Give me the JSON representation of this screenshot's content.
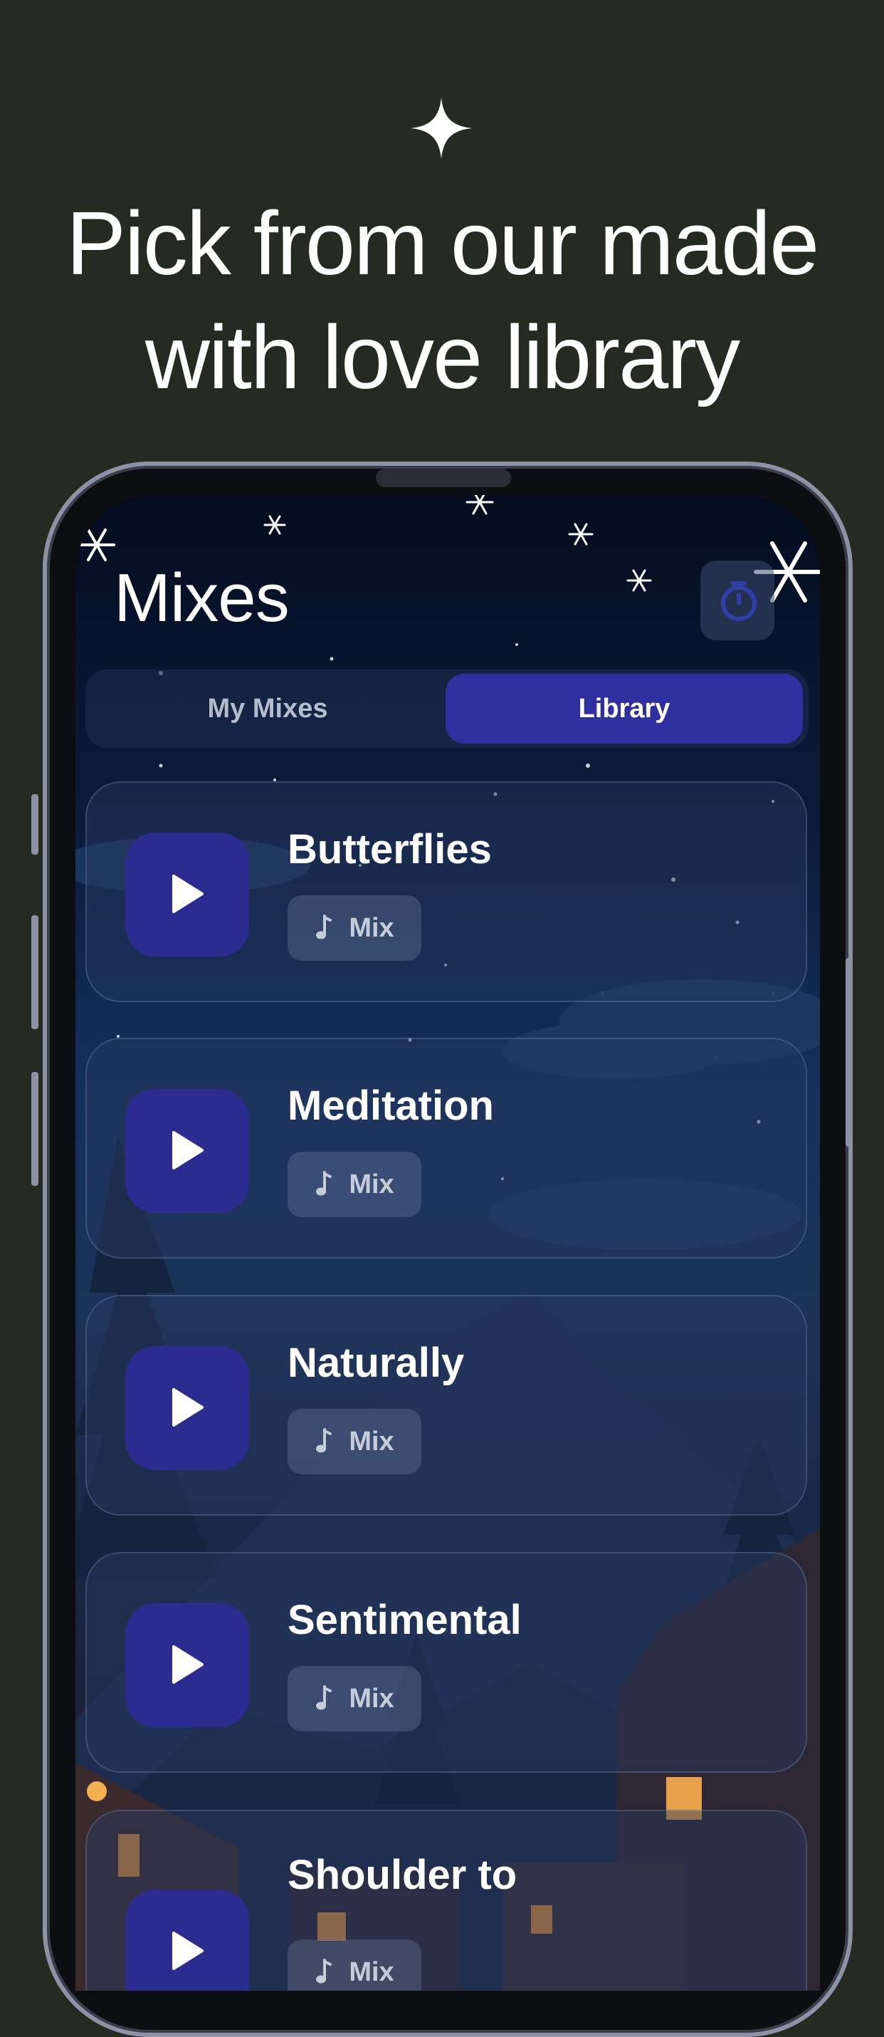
{
  "headline": {
    "line1": "Pick from our made",
    "line2": "with love library"
  },
  "app": {
    "title": "Mixes",
    "segments": {
      "my_mixes": "My Mixes",
      "library": "Library",
      "selected": "Library"
    },
    "mixes": [
      {
        "title": "Butterflies",
        "tag": "Mix"
      },
      {
        "title": "Meditation",
        "tag": "Mix"
      },
      {
        "title": "Naturally",
        "tag": "Mix"
      },
      {
        "title": "Sentimental",
        "tag": "Mix"
      },
      {
        "title": "Shoulder to",
        "tag": "Mix"
      }
    ]
  },
  "colors": {
    "background": "#252b20",
    "accent": "#2f2fa0",
    "play_button": "#2c2c90",
    "text": "#ffffff"
  },
  "icons": [
    "sparkle-icon",
    "snowflake-icon",
    "timer-icon",
    "play-icon",
    "music-note-icon"
  ]
}
